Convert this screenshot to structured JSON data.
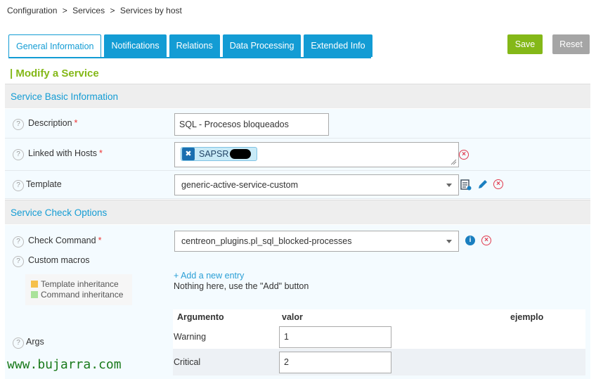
{
  "breadcrumb": [
    "Configuration",
    ">",
    "Services",
    ">",
    "Services by host"
  ],
  "tabs": [
    "General Information",
    "Notifications",
    "Relations",
    "Data Processing",
    "Extended Info"
  ],
  "buttons": {
    "save": "Save",
    "reset": "Reset"
  },
  "page_title": "| Modify a Service",
  "sections": {
    "basic": "Service Basic Information",
    "check": "Service Check Options"
  },
  "fields": {
    "description": {
      "label": "Description",
      "value": "SQL - Procesos bloqueados"
    },
    "hosts": {
      "label": "Linked with Hosts",
      "chip": "SAPSR"
    },
    "template": {
      "label": "Template",
      "value": "generic-active-service-custom"
    },
    "check_command": {
      "label": "Check Command",
      "value": "centreon_plugins.pl_sql_blocked-processes"
    },
    "custom_macros": {
      "label": "Custom macros",
      "add_entry": "+ Add a new entry",
      "empty_text": "Nothing here, use the \"Add\" button"
    },
    "args": {
      "label": "Args"
    }
  },
  "required_mark": "*",
  "legend": {
    "template": "Template inheritance",
    "command": "Command inheritance"
  },
  "args_table": {
    "headers": [
      "Argumento",
      "valor",
      "ejemplo"
    ],
    "rows": [
      {
        "name": "Warning",
        "value": "1"
      },
      {
        "name": "Critical",
        "value": "2"
      }
    ]
  },
  "watermark": "www.bujarra.com",
  "colors": {
    "accent": "#139cd4",
    "save": "#84b818",
    "reset": "#a5a5a5",
    "remove": "#e03a4e"
  }
}
